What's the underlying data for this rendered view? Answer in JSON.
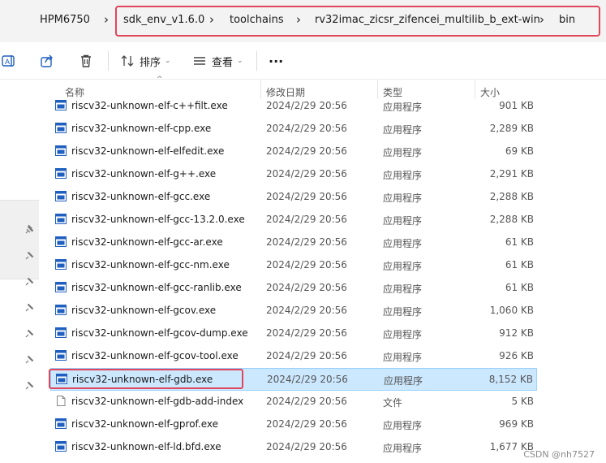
{
  "breadcrumb": {
    "items": [
      "HPM6750",
      "sdk_env_v1.6.0",
      "toolchains",
      "rv32imac_zicsr_zifencei_multilib_b_ext-win",
      "bin"
    ]
  },
  "toolbar": {
    "sort_label": "排序",
    "view_label": "查看",
    "more_label": "···"
  },
  "columns": {
    "name": "名称",
    "date": "修改日期",
    "type": "类型",
    "size": "大小"
  },
  "files": [
    {
      "name": "riscv32-unknown-elf-c++filt.exe",
      "date": "2024/2/29 20:56",
      "type": "应用程序",
      "size": "901 KB",
      "icon": "exe-icon"
    },
    {
      "name": "riscv32-unknown-elf-cpp.exe",
      "date": "2024/2/29 20:56",
      "type": "应用程序",
      "size": "2,289 KB",
      "icon": "exe-icon"
    },
    {
      "name": "riscv32-unknown-elf-elfedit.exe",
      "date": "2024/2/29 20:56",
      "type": "应用程序",
      "size": "69 KB",
      "icon": "exe-icon"
    },
    {
      "name": "riscv32-unknown-elf-g++.exe",
      "date": "2024/2/29 20:56",
      "type": "应用程序",
      "size": "2,291 KB",
      "icon": "exe-icon"
    },
    {
      "name": "riscv32-unknown-elf-gcc.exe",
      "date": "2024/2/29 20:56",
      "type": "应用程序",
      "size": "2,288 KB",
      "icon": "exe-icon"
    },
    {
      "name": "riscv32-unknown-elf-gcc-13.2.0.exe",
      "date": "2024/2/29 20:56",
      "type": "应用程序",
      "size": "2,288 KB",
      "icon": "exe-icon"
    },
    {
      "name": "riscv32-unknown-elf-gcc-ar.exe",
      "date": "2024/2/29 20:56",
      "type": "应用程序",
      "size": "61 KB",
      "icon": "exe-icon"
    },
    {
      "name": "riscv32-unknown-elf-gcc-nm.exe",
      "date": "2024/2/29 20:56",
      "type": "应用程序",
      "size": "61 KB",
      "icon": "exe-icon"
    },
    {
      "name": "riscv32-unknown-elf-gcc-ranlib.exe",
      "date": "2024/2/29 20:56",
      "type": "应用程序",
      "size": "61 KB",
      "icon": "exe-icon"
    },
    {
      "name": "riscv32-unknown-elf-gcov.exe",
      "date": "2024/2/29 20:56",
      "type": "应用程序",
      "size": "1,060 KB",
      "icon": "exe-icon"
    },
    {
      "name": "riscv32-unknown-elf-gcov-dump.exe",
      "date": "2024/2/29 20:56",
      "type": "应用程序",
      "size": "912 KB",
      "icon": "exe-icon"
    },
    {
      "name": "riscv32-unknown-elf-gcov-tool.exe",
      "date": "2024/2/29 20:56",
      "type": "应用程序",
      "size": "926 KB",
      "icon": "exe-icon"
    },
    {
      "name": "riscv32-unknown-elf-gdb.exe",
      "date": "2024/2/29 20:56",
      "type": "应用程序",
      "size": "8,152 KB",
      "icon": "exe-icon",
      "selected": true
    },
    {
      "name": "riscv32-unknown-elf-gdb-add-index",
      "date": "2024/2/29 20:56",
      "type": "文件",
      "size": "5 KB",
      "icon": "file-icon"
    },
    {
      "name": "riscv32-unknown-elf-gprof.exe",
      "date": "2024/2/29 20:56",
      "type": "应用程序",
      "size": "969 KB",
      "icon": "exe-icon"
    },
    {
      "name": "riscv32-unknown-elf-ld.bfd.exe",
      "date": "2024/2/29 20:56",
      "type": "应用程序",
      "size": "1,677 KB",
      "icon": "exe-icon"
    }
  ],
  "watermark": "CSDN @nh7527",
  "colors": {
    "highlight_border": "#e0455a",
    "selection_bg": "#cce8ff",
    "selection_border": "#99d1ff",
    "exe_icon_blue": "#1f5fbf"
  }
}
